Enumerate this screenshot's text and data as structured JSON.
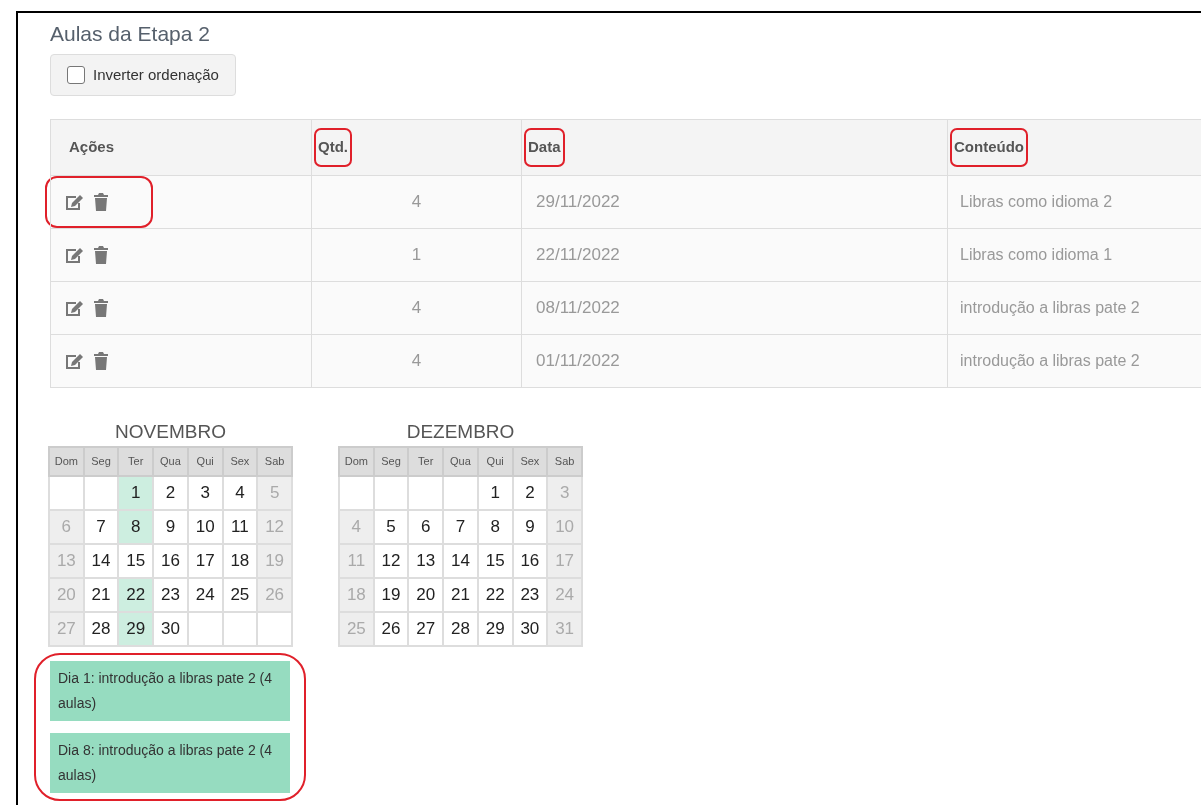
{
  "title": "Aulas da Etapa 2",
  "invert_order": {
    "label": "Inverter ordenação",
    "checked": false
  },
  "table": {
    "columns": [
      {
        "label": "Ações",
        "highlighted": false
      },
      {
        "label": "Qtd.",
        "highlighted": true
      },
      {
        "label": "Data",
        "highlighted": true
      },
      {
        "label": "Conteúdo",
        "highlighted": true
      }
    ],
    "rows": [
      {
        "actions_highlighted": true,
        "qtd": "4",
        "data": "29/11/2022",
        "conteudo": "Libras como idioma 2"
      },
      {
        "actions_highlighted": false,
        "qtd": "1",
        "data": "22/11/2022",
        "conteudo": "Libras como idioma 1"
      },
      {
        "actions_highlighted": false,
        "qtd": "4",
        "data": "08/11/2022",
        "conteudo": "introdução a libras pate 2"
      },
      {
        "actions_highlighted": false,
        "qtd": "4",
        "data": "01/11/2022",
        "conteudo": "introdução a libras pate 2"
      }
    ]
  },
  "calendars": [
    {
      "month": "NOVEMBRO",
      "weekdays": [
        "Dom",
        "Seg",
        "Ter",
        "Qua",
        "Qui",
        "Sex",
        "Sab"
      ],
      "weeks": [
        [
          {
            "kind": "empty"
          },
          {
            "kind": "empty"
          },
          {
            "day": "1",
            "marked": true
          },
          {
            "day": "2",
            "marked": false
          },
          {
            "day": "3",
            "marked": false
          },
          {
            "day": "4",
            "marked": false
          },
          {
            "day": "5",
            "marked": false
          }
        ],
        [
          {
            "day": "6",
            "marked": false
          },
          {
            "day": "7",
            "marked": false
          },
          {
            "day": "8",
            "marked": true
          },
          {
            "day": "9",
            "marked": false
          },
          {
            "day": "10",
            "marked": false
          },
          {
            "day": "11",
            "marked": false
          },
          {
            "day": "12",
            "marked": false
          }
        ],
        [
          {
            "day": "13",
            "marked": false
          },
          {
            "day": "14",
            "marked": false
          },
          {
            "day": "15",
            "marked": false
          },
          {
            "day": "16",
            "marked": false
          },
          {
            "day": "17",
            "marked": false
          },
          {
            "day": "18",
            "marked": false
          },
          {
            "day": "19",
            "marked": false
          }
        ],
        [
          {
            "day": "20",
            "marked": false
          },
          {
            "day": "21",
            "marked": false
          },
          {
            "day": "22",
            "marked": true
          },
          {
            "day": "23",
            "marked": false
          },
          {
            "day": "24",
            "marked": false
          },
          {
            "day": "25",
            "marked": false
          },
          {
            "day": "26",
            "marked": false
          }
        ],
        [
          {
            "day": "27",
            "marked": false
          },
          {
            "day": "28",
            "marked": false
          },
          {
            "day": "29",
            "marked": true
          },
          {
            "day": "30",
            "marked": false
          },
          {
            "kind": "empty"
          },
          {
            "kind": "empty"
          },
          {
            "kind": "empty"
          }
        ]
      ]
    },
    {
      "month": "DEZEMBRO",
      "weekdays": [
        "Dom",
        "Seg",
        "Ter",
        "Qua",
        "Qui",
        "Sex",
        "Sab"
      ],
      "weeks": [
        [
          {
            "kind": "empty"
          },
          {
            "kind": "empty"
          },
          {
            "kind": "empty"
          },
          {
            "kind": "empty"
          },
          {
            "day": "1",
            "marked": false
          },
          {
            "day": "2",
            "marked": false
          },
          {
            "day": "3",
            "marked": false
          }
        ],
        [
          {
            "day": "4",
            "marked": false
          },
          {
            "day": "5",
            "marked": false
          },
          {
            "day": "6",
            "marked": false
          },
          {
            "day": "7",
            "marked": false
          },
          {
            "day": "8",
            "marked": false
          },
          {
            "day": "9",
            "marked": false
          },
          {
            "day": "10",
            "marked": false
          }
        ],
        [
          {
            "day": "11",
            "marked": false
          },
          {
            "day": "12",
            "marked": false
          },
          {
            "day": "13",
            "marked": false
          },
          {
            "day": "14",
            "marked": false
          },
          {
            "day": "15",
            "marked": false
          },
          {
            "day": "16",
            "marked": false
          },
          {
            "day": "17",
            "marked": false
          }
        ],
        [
          {
            "day": "18",
            "marked": false
          },
          {
            "day": "19",
            "marked": false
          },
          {
            "day": "20",
            "marked": false
          },
          {
            "day": "21",
            "marked": false
          },
          {
            "day": "22",
            "marked": false
          },
          {
            "day": "23",
            "marked": false
          },
          {
            "day": "24",
            "marked": false
          }
        ],
        [
          {
            "day": "25",
            "marked": false
          },
          {
            "day": "26",
            "marked": false
          },
          {
            "day": "27",
            "marked": false
          },
          {
            "day": "28",
            "marked": false
          },
          {
            "day": "29",
            "marked": false
          },
          {
            "day": "30",
            "marked": false
          },
          {
            "day": "31",
            "marked": false
          }
        ]
      ]
    }
  ],
  "events": {
    "highlighted": true,
    "items": [
      "Dia 1: introdução a libras pate 2 (4 aulas)",
      "Dia 8: introdução a libras pate 2 (4 aulas)"
    ]
  }
}
